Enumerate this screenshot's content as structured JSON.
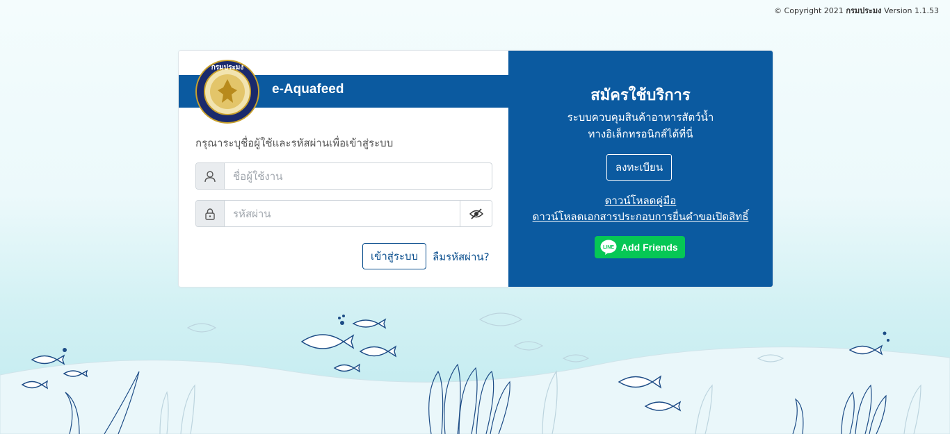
{
  "copyright": {
    "prefix": "© Copyright 2021",
    "org": "กรมประมง",
    "version": "Version 1.1.53"
  },
  "brand": {
    "title": "e-Aquafeed",
    "seal_text": "กรมประมง"
  },
  "login": {
    "instruction": "กรุณาระบุชื่อผู้ใช้และรหัสผ่านเพื่อเข้าสู่ระบบ",
    "username_placeholder": "ชื่อผู้ใช้งาน",
    "password_placeholder": "รหัสผ่าน",
    "login_label": "เข้าสู่ระบบ",
    "forgot_label": "ลืมรหัสผ่าน?"
  },
  "register": {
    "title": "สมัครใช้บริการ",
    "subtitle_line1": "ระบบควบคุมสินค้าอาหารสัตว์น้ำ",
    "subtitle_line2": "ทางอิเล็กทรอนิกส์ได้ที่นี่",
    "register_label": "ลงทะเบียน",
    "download_manual": "ดาวน์โหลดคู่มือ",
    "download_docs": "ดาวน์โหลดเอกสารประกอบการยื่นคำขอเปิดสิทธิ์",
    "line_badge": "LINE",
    "line_label": "Add Friends"
  },
  "icons": {
    "user": "user-icon",
    "lock": "lock-icon",
    "eye": "eye-slash-icon",
    "line": "line-icon"
  },
  "colors": {
    "primary": "#0b5aa0",
    "line_green": "#06c755",
    "link_dark": "#0b4f8e"
  }
}
